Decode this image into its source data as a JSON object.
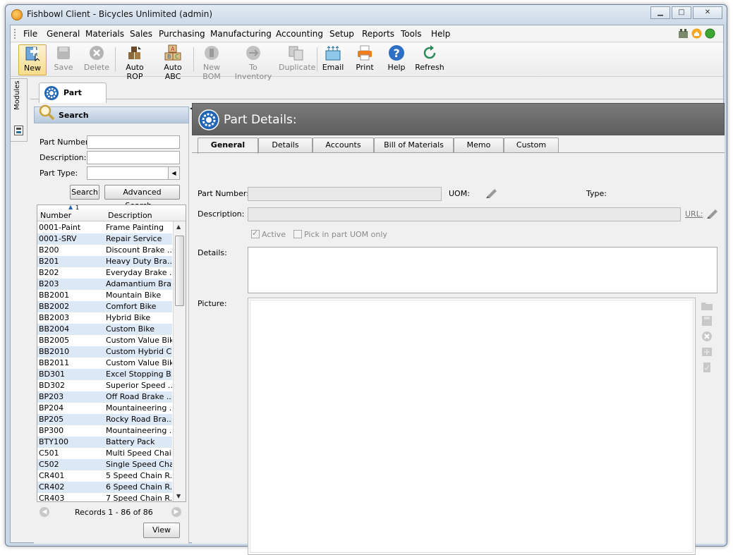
{
  "window": {
    "title": "Fishbowl Client - Bicycles Unlimited (admin)",
    "minimize_glyph": "▁",
    "maximize_glyph": "□",
    "close_glyph": "✕"
  },
  "menu": [
    "File",
    "General",
    "Materials",
    "Sales",
    "Purchasing",
    "Manufacturing",
    "Accounting",
    "Setup",
    "Reports",
    "Tools",
    "Help"
  ],
  "toolbar": {
    "new": "New",
    "save": "Save",
    "delete": "Delete",
    "auto_rop": "Auto ROP",
    "auto_abc": "Auto ABC",
    "new_bom": "New BOM",
    "to_inventory": "To Inventory",
    "duplicate": "Duplicate",
    "email": "Email",
    "print": "Print",
    "help": "Help",
    "refresh": "Refresh"
  },
  "sidebar": {
    "modules_label": "Modules"
  },
  "module_tab": {
    "label": "Part"
  },
  "search": {
    "title": "Search",
    "part_number_label": "Part Number:",
    "description_label": "Description:",
    "part_type_label": "Part Type:",
    "search_button": "Search",
    "advanced_button": "Advanced Search...",
    "columns": {
      "number": "Number",
      "description": "Description",
      "sort_indicator": "1"
    },
    "rows": [
      {
        "number": "0001-Paint",
        "description": "Frame Painting"
      },
      {
        "number": "0001-SRV",
        "description": "Repair Service"
      },
      {
        "number": "B200",
        "description": "Discount Brake ..."
      },
      {
        "number": "B201",
        "description": "Heavy Duty Bra..."
      },
      {
        "number": "B202",
        "description": "Everyday Brake ..."
      },
      {
        "number": "B203",
        "description": "Adamantium Bra..."
      },
      {
        "number": "BB2001",
        "description": "Mountain Bike"
      },
      {
        "number": "BB2002",
        "description": "Comfort Bike"
      },
      {
        "number": "BB2003",
        "description": "Hybrid Bike"
      },
      {
        "number": "BB2004",
        "description": "Custom Bike"
      },
      {
        "number": "BB2005",
        "description": "Custom Value Bike"
      },
      {
        "number": "BB2010",
        "description": "Custom Hybrid C..."
      },
      {
        "number": "BB2011",
        "description": "Custom Value Bike"
      },
      {
        "number": "BD301",
        "description": "Excel Stopping B..."
      },
      {
        "number": "BD302",
        "description": "Superior Speed ..."
      },
      {
        "number": "BP203",
        "description": "Off Road Brake ..."
      },
      {
        "number": "BP204",
        "description": "Mountaineering ..."
      },
      {
        "number": "BP205",
        "description": "Rocky Road Bra..."
      },
      {
        "number": "BP300",
        "description": "Mountaineering ..."
      },
      {
        "number": "BTY100",
        "description": "Battery Pack"
      },
      {
        "number": "C501",
        "description": "Multi Speed Chain"
      },
      {
        "number": "C502",
        "description": "Single Speed Chain"
      },
      {
        "number": "CR401",
        "description": "5 Speed Chain R..."
      },
      {
        "number": "CR402",
        "description": "6 Speed Chain R..."
      },
      {
        "number": "CR403",
        "description": "7 Speed Chain R..."
      }
    ],
    "records_text": "Records 1 - 86 of 86",
    "view_button": "View"
  },
  "details": {
    "title": "Part Details:",
    "tabs": [
      "General",
      "Details",
      "Accounts",
      "Bill of Materials",
      "Memo",
      "Custom"
    ],
    "part_number_label": "Part Number:",
    "uom_label": "UOM:",
    "type_label": "Type:",
    "description_label": "Description:",
    "url_label": "URL:",
    "active_label": "Active",
    "pick_uom_label": "Pick in part UOM only",
    "details_label": "Details:",
    "picture_label": "Picture:"
  },
  "colors": {
    "accent_blue": "#1f64b5",
    "header_gray": "#6a6a6a",
    "row_alt": "#dde8f6"
  }
}
